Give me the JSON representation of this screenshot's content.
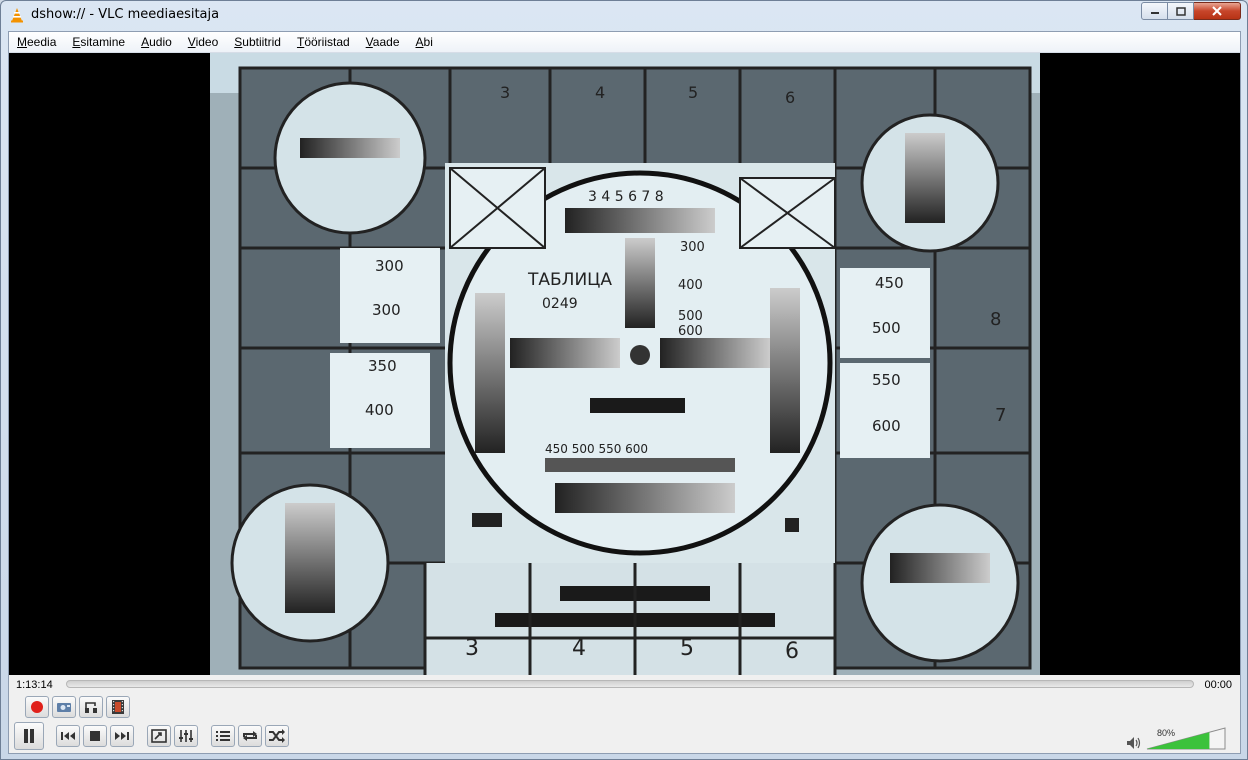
{
  "window": {
    "title": "dshow:// - VLC meediaesitaja",
    "app_icon": "vlc-cone-icon"
  },
  "menu": [
    {
      "label": "Meedia",
      "accel": "M",
      "rest": "eedia"
    },
    {
      "label": "Esitamine",
      "accel": "E",
      "rest": "sitamine"
    },
    {
      "label": "Audio",
      "accel": "A",
      "rest": "udio"
    },
    {
      "label": "Video",
      "accel": "V",
      "rest": "ideo"
    },
    {
      "label": "Subtiitrid",
      "accel": "S",
      "rest": "ubtiitrid"
    },
    {
      "label": "Tööriistad",
      "accel": "T",
      "rest": "ööriistad"
    },
    {
      "label": "Vaade",
      "accel": "V",
      "rest": "aade"
    },
    {
      "label": "Abi",
      "accel": "A",
      "rest": "bi"
    }
  ],
  "test_pattern": {
    "top_numbers": [
      "3",
      "4",
      "5",
      "6"
    ],
    "center_scale": "3 4 5 6 7 8",
    "center_title": "ТАБЛИЦА",
    "center_sub": "0249",
    "center_values": [
      "300",
      "400",
      "500",
      "600"
    ],
    "bottom_scale": "450  500  550  600",
    "left_values": [
      "300",
      "300",
      "350",
      "400"
    ],
    "right_values": [
      "450",
      "500",
      "550",
      "600"
    ],
    "side_letters": [
      "8",
      "7"
    ],
    "bottom_numbers": [
      "3",
      "4",
      "5",
      "6"
    ]
  },
  "playback": {
    "elapsed": "1:13:14",
    "total": "00:00",
    "progress": 0
  },
  "volume": {
    "percent_label": "80%",
    "level": 0.8
  },
  "colors": {
    "record": "#e0201a",
    "volume_fill": "#3cc23c"
  }
}
